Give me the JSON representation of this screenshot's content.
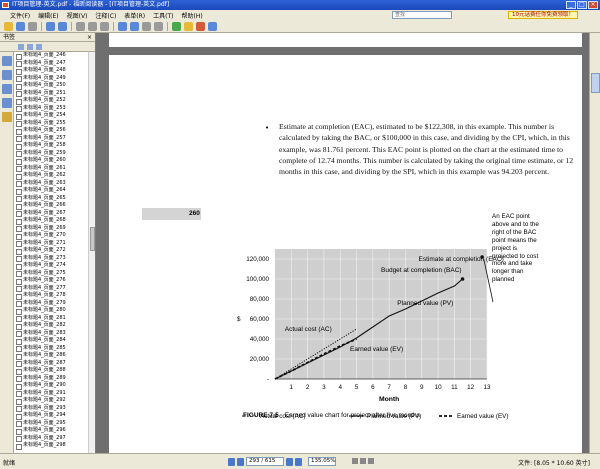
{
  "window": {
    "title": "IT项目管理-英文.pdf - 福昕阅读器 - [IT项目管理-英文.pdf]",
    "min": "_",
    "max": "□",
    "close": "×"
  },
  "menu": {
    "items": [
      "文件(F)",
      "编辑(E)",
      "视图(V)",
      "注释(C)",
      "表单(R)",
      "工具(T)",
      "帮助(H)"
    ],
    "search_placeholder": "查找",
    "ad": "10元话费任你免费领取！"
  },
  "sidebar": {
    "title": "书签",
    "close": "×",
    "items": [
      "未标题4_页面_246",
      "未标题4_页面_247",
      "未标题4_页面_248",
      "未标题4_页面_249",
      "未标题4_页面_250",
      "未标题4_页面_251",
      "未标题4_页面_252",
      "未标题4_页面_253",
      "未标题4_页面_254",
      "未标题4_页面_255",
      "未标题4_页面_256",
      "未标题4_页面_257",
      "未标题4_页面_258",
      "未标题4_页面_259",
      "未标题4_页面_260",
      "未标题4_页面_261",
      "未标题4_页面_262",
      "未标题4_页面_263",
      "未标题4_页面_264",
      "未标题4_页面_265",
      "未标题4_页面_266",
      "未标题4_页面_267",
      "未标题4_页面_268",
      "未标题4_页面_269",
      "未标题4_页面_270",
      "未标题4_页面_271",
      "未标题4_页面_272",
      "未标题4_页面_273",
      "未标题4_页面_274",
      "未标题4_页面_275",
      "未标题4_页面_276",
      "未标题4_页面_277",
      "未标题4_页面_278",
      "未标题4_页面_279",
      "未标题4_页面_280",
      "未标题4_页面_281",
      "未标题4_页面_282",
      "未标题4_页面_283",
      "未标题4_页面_284",
      "未标题4_页面_285",
      "未标题4_页面_286",
      "未标题4_页面_287",
      "未标题4_页面_288",
      "未标题4_页面_289",
      "未标题4_页面_290",
      "未标题4_页面_291",
      "未标题4_页面_292",
      "未标题4_页面_293",
      "未标题4_页面_294",
      "未标题4_页面_295",
      "未标题4_页面_296",
      "未标题4_页面_297",
      "未标题4_页面_298"
    ]
  },
  "document": {
    "paragraph": "Estimate at completion (EAC), estimated to be $122,308, in this example. This number is calculated by taking the BAC, or $100,000 in this case, and dividing by the CPI, which, in this example, was 81.761 percent. This EAC point is plotted on the chart at the estimated time to complete of 12.74 months. This number is calculated by taking the original time estimate, or 12 months in this case, and dividing by the SPI, which in this example was 94.203 percent.",
    "page_number": "260",
    "side_note": "An EAC point above and to the right of the BAC point means the project is projected to cost more and take longer than planned",
    "figure_label": "FIGURE 7-5",
    "figure_caption": "Earned value chart for project after five months"
  },
  "chart_data": {
    "type": "line",
    "x": [
      0,
      1,
      2,
      3,
      4,
      5,
      6,
      7,
      8,
      9,
      10,
      11,
      12,
      13
    ],
    "xlabel": "Month",
    "ylabel": "$",
    "xlim": [
      0,
      13
    ],
    "ylim": [
      0,
      130000
    ],
    "yticks": [
      "-",
      "20,000",
      "40,000",
      "60,000",
      "80,000",
      "100,000",
      "120,000"
    ],
    "ytick_values": [
      0,
      20000,
      40000,
      60000,
      80000,
      100000,
      120000
    ],
    "xticks": [
      "1",
      "2",
      "3",
      "4",
      "5",
      "6",
      "7",
      "8",
      "9",
      "10",
      "11",
      "12",
      "13"
    ],
    "grid": true,
    "series": [
      {
        "name": "Planned value (PV)",
        "style": "solid",
        "x": [
          0,
          1,
          2,
          3,
          4,
          5,
          6,
          7,
          8,
          9,
          10,
          11,
          11.5
        ],
        "values": [
          0,
          8000,
          16000,
          24000,
          32000,
          41000,
          52000,
          63000,
          70000,
          78000,
          86000,
          93000,
          100000
        ]
      },
      {
        "name": "Actual cost (AC)",
        "style": "dotted",
        "x": [
          0,
          1,
          2,
          3,
          4,
          5
        ],
        "values": [
          0,
          10000,
          20000,
          30000,
          40000,
          50000
        ]
      },
      {
        "name": "Earned value (EV)",
        "style": "dashed",
        "x": [
          0,
          1,
          2,
          3,
          4,
          5
        ],
        "values": [
          0,
          8000,
          16500,
          25000,
          33000,
          40000
        ]
      }
    ],
    "annotations": [
      {
        "text": "Estimate at completion (EAC)",
        "x": 12.7,
        "y": 122000
      },
      {
        "text": "Budget at completion (BAC)",
        "x": 11.5,
        "y": 100000
      },
      {
        "text": "Planned value (PV)",
        "x": 8,
        "y": 70000
      },
      {
        "text": "Actual cost (AC)",
        "x": 3,
        "y": 50000
      },
      {
        "text": "Earned value (EV)",
        "x": 6,
        "y": 35000
      }
    ],
    "legend": [
      "Actual cost (AC)",
      "Planned value (PV)",
      "Earned value (EV)"
    ],
    "legend_position": "bottom",
    "colors": {
      "line": "#111111",
      "plot_bg": "#cfcfcf"
    }
  },
  "status": {
    "ready": "就绪",
    "page": "293 / 615",
    "zoom": "135.05%",
    "size": "文件: [8.05 * 10.60 英寸]"
  }
}
